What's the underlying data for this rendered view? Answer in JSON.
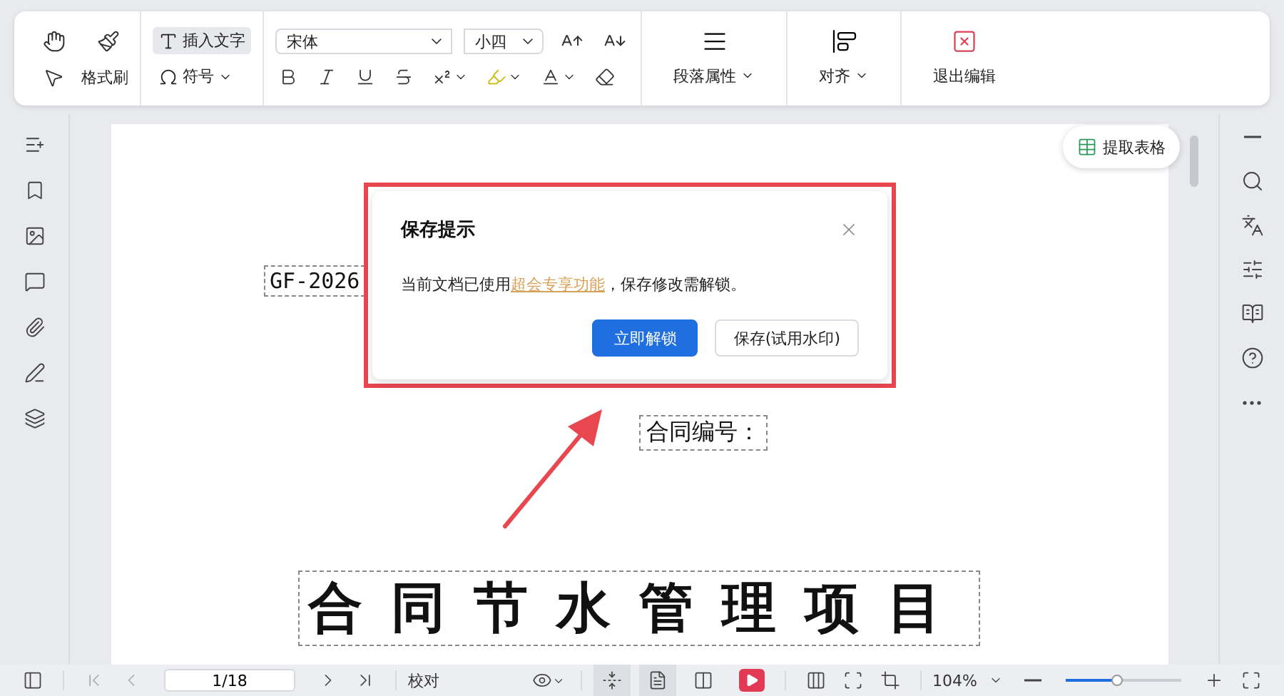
{
  "toolbar": {
    "format_painter": "格式刷",
    "insert_text": {
      "label": "插入文字",
      "selected": true
    },
    "symbol": "符号",
    "font": "宋体",
    "font_size": "小四",
    "paragraph": "段落属性",
    "align": "对齐",
    "exit": "退出编辑"
  },
  "extract_table_button": "提取表格",
  "document": {
    "code": "GF-2026",
    "contract_no": "合同编号：",
    "title": "合同节水管理项目"
  },
  "dialog": {
    "title": "保存提示",
    "message_before": "当前文档已使用",
    "link": "超会专享功能",
    "message_after": "，保存修改需解锁。",
    "primary_button": "立即解锁",
    "secondary_button": "保存(试用水印)"
  },
  "status_bar": {
    "page": "1/18",
    "proofread": "校对",
    "zoom": "104%",
    "zoom_slider": {
      "level": 0.44
    },
    "view_modes": [
      {
        "selected": true
      },
      {
        "selected": true
      },
      {
        "selected": false
      }
    ]
  }
}
